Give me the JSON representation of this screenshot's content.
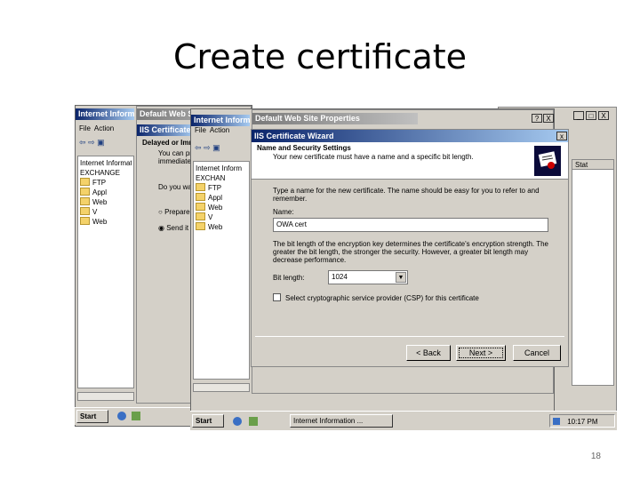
{
  "slide": {
    "title": "Create certificate",
    "page_number": "18"
  },
  "bg_window_1": {
    "title": "Internet Information Services",
    "menu": [
      "File",
      "Action"
    ],
    "tree": [
      "Internet Information",
      "EXCHANGE",
      "FTP",
      "Appl",
      "Web",
      "V",
      "Web"
    ]
  },
  "bg_dialog_1": {
    "title": "Default Web Site Properties",
    "subtitle": "IIS Certificate Wizard",
    "heading": "Delayed or Immediate Request",
    "lines": [
      "You can prepare",
      "immediately send"
    ],
    "question": "Do you want to",
    "options": [
      "Prepare",
      "Send it"
    ]
  },
  "bg_window_2": {
    "title": "Internet Information Services",
    "menu": [
      "File",
      "Action"
    ],
    "tree": [
      "Internet Inform",
      "EXCHAN",
      "FTP",
      "Appl",
      "Web",
      "V",
      "Web"
    ]
  },
  "bg_dialog_2": {
    "title": "Default Web Site Properties",
    "help": "?",
    "close": "X"
  },
  "wizard": {
    "title": "IIS Certificate Wizard",
    "close": "x",
    "header_title": "Name and Security Settings",
    "header_sub": "Your new certificate must have a name and a specific bit length.",
    "intro": "Type a name for the new certificate. The name should be easy for you to refer to and remember.",
    "name_label": "Name:",
    "name_value": "OWA cert",
    "bitlength_text": "The bit length of the encryption key determines the certificate's encryption strength. The greater the bit length, the stronger the security. However, a greater bit length may decrease performance.",
    "bitlength_label": "Bit length:",
    "bitlength_value": "1024",
    "csp_label": "Select cryptographic service provider (CSP) for this certificate",
    "back_label": "< Back",
    "next_label": "Next >",
    "cancel_label": "Cancel"
  },
  "right_window": {
    "min": "_",
    "max": "□",
    "close": "X",
    "col_header": "Stat"
  },
  "taskbar_1": {
    "start": "Start"
  },
  "taskbar_2": {
    "start": "Start",
    "task": "Internet Information ...",
    "clock": "10:17 PM"
  }
}
